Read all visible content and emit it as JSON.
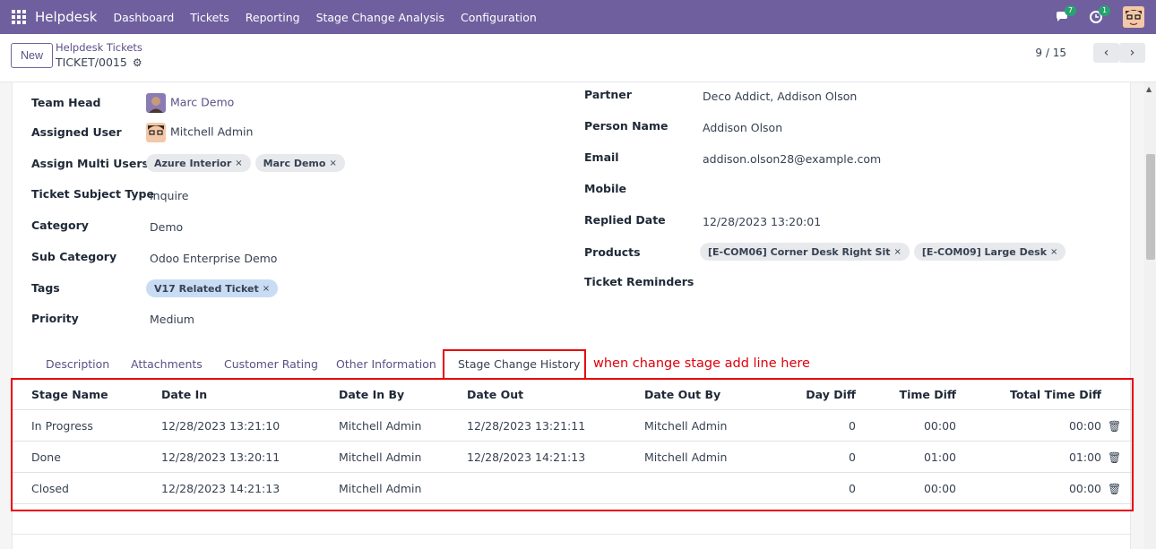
{
  "navbar": {
    "app_name": "Helpdesk",
    "menu": [
      "Dashboard",
      "Tickets",
      "Reporting",
      "Stage Change Analysis",
      "Configuration"
    ],
    "messages_count": "7",
    "activities_count": "1"
  },
  "control": {
    "new_label": "New",
    "breadcrumb": "Helpdesk Tickets",
    "record_name": "TICKET/0015",
    "pager": "9 / 15"
  },
  "left_fields": {
    "team_head": {
      "label": "Team Head",
      "value": "Marc Demo"
    },
    "assigned_user": {
      "label": "Assigned User",
      "value": "Mitchell Admin"
    },
    "multi_users": {
      "label": "Assign Multi Users",
      "tags": [
        "Azure Interior",
        "Marc Demo"
      ]
    },
    "subject_type": {
      "label": "Ticket Subject Type",
      "value": "Inquire"
    },
    "category": {
      "label": "Category",
      "value": "Demo"
    },
    "sub_category": {
      "label": "Sub Category",
      "value": "Odoo Enterprise Demo"
    },
    "tags": {
      "label": "Tags",
      "tags": [
        "V17 Related Ticket"
      ]
    },
    "priority": {
      "label": "Priority",
      "value": "Medium"
    }
  },
  "right_fields": {
    "partner": {
      "label": "Partner",
      "value": "Deco Addict, Addison Olson"
    },
    "person_name": {
      "label": "Person Name",
      "value": "Addison Olson"
    },
    "email": {
      "label": "Email",
      "value": "addison.olson28@example.com"
    },
    "mobile": {
      "label": "Mobile",
      "value": ""
    },
    "replied_date": {
      "label": "Replied Date",
      "value": "12/28/2023 13:20:01"
    },
    "products": {
      "label": "Products",
      "tags": [
        "[E-COM06] Corner Desk Right Sit",
        "[E-COM09] Large Desk"
      ]
    },
    "ticket_reminders": {
      "label": "Ticket Reminders",
      "value": ""
    }
  },
  "tabs": [
    "Description",
    "Attachments",
    "Customer Rating",
    "Other Information",
    "Stage Change History"
  ],
  "annotation": "when change stage add line here",
  "table": {
    "headers": [
      "Stage Name",
      "Date In",
      "Date In By",
      "Date Out",
      "Date Out By",
      "Day Diff",
      "Time Diff",
      "Total Time Diff"
    ],
    "rows": [
      [
        "In Progress",
        "12/28/2023 13:21:10",
        "Mitchell Admin",
        "12/28/2023 13:21:11",
        "Mitchell Admin",
        "0",
        "00:00",
        "00:00"
      ],
      [
        "Done",
        "12/28/2023 13:20:11",
        "Mitchell Admin",
        "12/28/2023 14:21:13",
        "Mitchell Admin",
        "0",
        "01:00",
        "01:00"
      ],
      [
        "Closed",
        "12/28/2023 14:21:13",
        "Mitchell Admin",
        "",
        "",
        "0",
        "00:00",
        "00:00"
      ]
    ]
  }
}
